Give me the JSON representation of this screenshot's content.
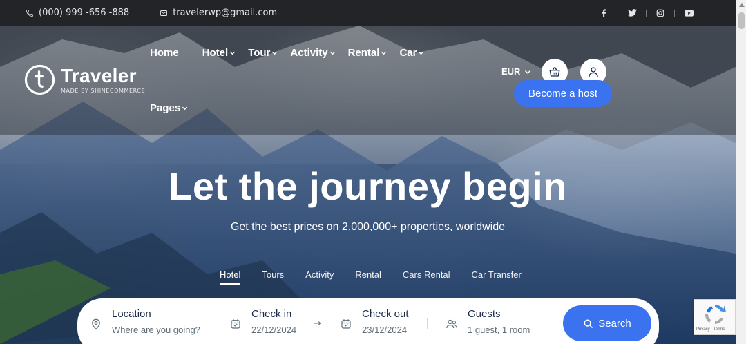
{
  "topbar": {
    "phone": "(000) 999 -656 -888",
    "email": "travelerwp@gmail.com",
    "social": [
      "facebook-icon",
      "twitter-icon",
      "instagram-icon",
      "youtube-icon"
    ]
  },
  "brand": {
    "name": "Traveler",
    "tagline": "MADE BY SHINECOMMERCE",
    "accent": "#3b72f0"
  },
  "nav": {
    "items": [
      "Home",
      "Hotel",
      "Tour",
      "Activity",
      "Rental",
      "Car"
    ],
    "second_row": "Pages"
  },
  "header": {
    "currency": "EUR",
    "host_button": "Become a host"
  },
  "hero": {
    "title": "Let the journey begin",
    "subtitle": "Get the best prices on 2,000,000+ properties, worldwide"
  },
  "tabs": [
    "Hotel",
    "Tours",
    "Activity",
    "Rental",
    "Cars Rental",
    "Car Transfer"
  ],
  "active_tab": "Hotel",
  "search": {
    "location_label": "Location",
    "location_placeholder": "Where are you going?",
    "checkin_label": "Check in",
    "checkin_value": "22/12/2024",
    "checkout_label": "Check out",
    "checkout_value": "23/12/2024",
    "guests_label": "Guests",
    "guests_value": "1 guest, 1 room",
    "button": "Search"
  },
  "recaptcha": {
    "text": "Privacy - Terms"
  }
}
